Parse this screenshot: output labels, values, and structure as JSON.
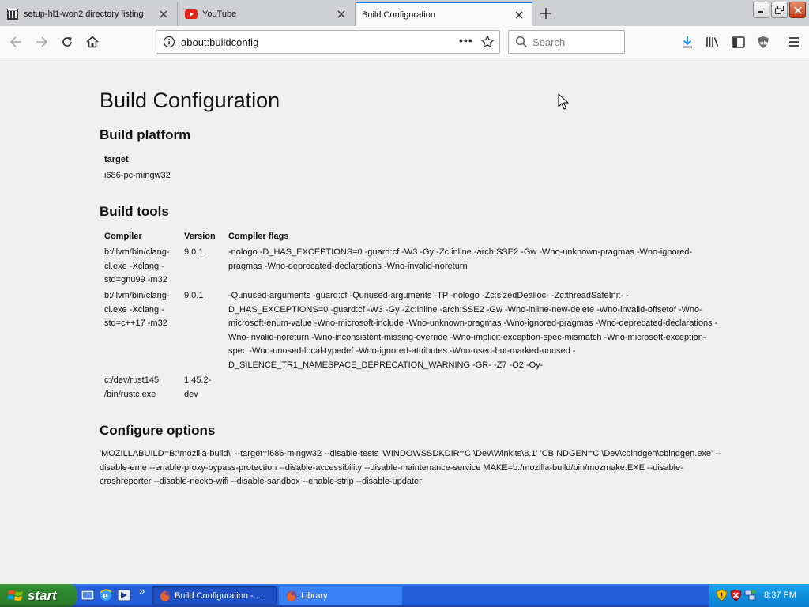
{
  "browser": {
    "tabs": [
      {
        "title": "setup-hl1-won2 directory listing",
        "icon": "archive-icon",
        "active": false
      },
      {
        "title": "YouTube",
        "icon": "youtube-icon",
        "active": false
      },
      {
        "title": "Build Configuration",
        "icon": "",
        "active": true
      }
    ],
    "url": "about:buildconfig",
    "search_placeholder": "Search",
    "page_actions_label": "•••"
  },
  "page": {
    "title": "Build Configuration",
    "platform": {
      "heading": "Build platform",
      "target_label": "target",
      "target_value": "i686-pc-mingw32"
    },
    "tools": {
      "heading": "Build tools",
      "headers": [
        "Compiler",
        "Version",
        "Compiler flags"
      ],
      "rows": [
        {
          "compiler": "b:/llvm/bin/clang-cl.exe -Xclang -std=gnu99 -m32",
          "version": "9.0.1",
          "flags": "-nologo -D_HAS_EXCEPTIONS=0 -guard:cf -W3 -Gy -Zc:inline -arch:SSE2 -Gw -Wno-unknown-pragmas -Wno-ignored-pragmas -Wno-deprecated-declarations -Wno-invalid-noreturn"
        },
        {
          "compiler": "b:/llvm/bin/clang-cl.exe -Xclang -std=c++17 -m32",
          "version": "9.0.1",
          "flags": "-Qunused-arguments -guard:cf -Qunused-arguments -TP -nologo -Zc:sizedDealloc- -Zc:threadSafeInit- -D_HAS_EXCEPTIONS=0 -guard:cf -W3 -Gy -Zc:inline -arch:SSE2 -Gw -Wno-inline-new-delete -Wno-invalid-offsetof -Wno-microsoft-enum-value -Wno-microsoft-include -Wno-unknown-pragmas -Wno-ignored-pragmas -Wno-deprecated-declarations -Wno-invalid-noreturn -Wno-inconsistent-missing-override -Wno-implicit-exception-spec-mismatch -Wno-microsoft-exception-spec -Wno-unused-local-typedef -Wno-ignored-attributes -Wno-used-but-marked-unused -D_SILENCE_TR1_NAMESPACE_DEPRECATION_WARNING -GR- -Z7 -O2 -Oy-"
        },
        {
          "compiler": "c:/dev/rust145 /bin/rustc.exe",
          "version": "1.45.2-dev",
          "flags": ""
        }
      ]
    },
    "configure": {
      "heading": "Configure options",
      "text": "'MOZILLABUILD=B:\\mozilla-build\\' --target=i686-mingw32 --disable-tests 'WINDOWSSDKDIR=C:\\Dev\\Winkits\\8.1' 'CBINDGEN=C:\\Dev\\cbindgen\\cbindgen.exe' --disable-eme --enable-proxy-bypass-protection --disable-accessibility --disable-maintenance-service MAKE=b:/mozilla-build/bin/mozmake.EXE --disable-crashreporter --disable-necko-wifi --disable-sandbox --enable-strip --disable-updater"
    }
  },
  "taskbar": {
    "start_label": "start",
    "quick_launch_more": "»",
    "tasks": [
      {
        "label": "Build Configuration - ...",
        "active": true
      },
      {
        "label": "Library",
        "active": false
      }
    ],
    "clock": "8:37 PM"
  },
  "colors": {
    "accent": "#0a84ff",
    "taskbar_blue": "#245edb",
    "start_green": "#2f8a2f"
  }
}
